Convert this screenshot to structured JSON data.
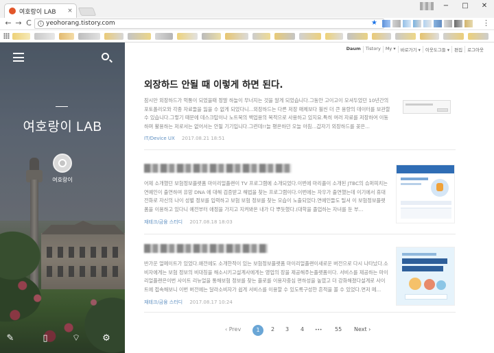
{
  "browser": {
    "tab_title": "여호랑이 LAB",
    "tab_close": "×",
    "window_buttons": [
      "−",
      "□",
      "✕"
    ],
    "nav": {
      "back": "←",
      "forward": "→",
      "reload": "C"
    },
    "url": "yeohorang.tistory.com",
    "star": "★",
    "menu": "⋮"
  },
  "sidebar": {
    "blog_title": "여호랑이 LAB",
    "nickname": "여호랑이",
    "footer_icons": [
      "pencil-icon",
      "notebook-icon",
      "rss-icon",
      "gear-icon"
    ]
  },
  "topnav": {
    "items": [
      "Daum",
      "Tistory",
      "My ▾",
      "바로가기 ▾",
      "이웃도그들 ▾",
      "편집",
      "로그아웃"
    ]
  },
  "posts": [
    {
      "title": "외장하드 안될 때 이렇게 하면 된다.",
      "excerpt": "잠시만 외장하드가 먹통이 되었을때 정말 하늘이 무너지는 것을 알게 되었습니다.그동안 고이고이 모셔두었던 10년간의 포토폴리오와 각종 자료들을 잃을 수 없게 되었다니...외장하드는 다른 저장 매체보다 훨씬 더 큰 용량의 데이터를 보관할 수 있습니다.그렇기 때문에 데스크탑이나 노트북의 백업용의 목적으로 사용하고 있지요.특히 여러 자료를 저장하여 이동하며 활용하는 저로서는 없어서는 안될 기기입니다.그런데!!늘 평온하던 오늘 아침...갑자기 외장하드를 꽂은...",
      "category": "IT/Device UX",
      "date": "2017.08.21 18:51"
    },
    {
      "title": "",
      "excerpt": "어제 소개했던 보험정보플랫폼 마이리얼플랜이 TV 프로그램에 소개되었다.이번에 마리플이 소개된 JTBC의 슈퍼피치는 연예인이 출연하여 유망 DNA 에 대해 검증받고 해법을 찾는 프로그램이다.이번에는 자우가 출연했는데 이기에서 휴대전화로 자신의 나이 성별 정보를 입력하고 보험 보험 정보를 찾는 모습이 노출되었다.연예인들도 틸셔 이 보험정보플랫폼을 이용하고 있다니 예전부터 애정을 가지고 지켜봐온 내가 다 뿌듯했다.(대학을 졸업하는 자녀를 둔 부...",
      "category": "재테크/금융 스터디",
      "date": "2017.08.18 18:03"
    },
    {
      "title": "",
      "excerpt": "반가운 얼메이트가 있었다.얘전에도 소개한적이 있는 보험정보플랫폼 마이리얼플랜이새로운 버전으로 다시 나타났다.소비자에게는 보험 정보의 비대칭을 해소시키고설계사에게는 영업의 장을 제공해주는플랫폼이다. 서비스를 제공하는 마이리얼플랜은이번 사이트 리뉴얼을 통해보험 정보를 찾는 플로를 이용자중심 편하성을 높였고 더 강화해졌다설계로 사이트에 접속해보니 이번 버전에는 달라소비자가 쉽게 서비스를 이용할 수 있도록구성한 흔적을 볼 수 있었다.면저 메...",
      "category": "재테크/금융 스터디",
      "date": "2017.08.17 10:24"
    }
  ],
  "pagination": {
    "prev": "‹ Prev",
    "pages": [
      "1",
      "2",
      "3",
      "4"
    ],
    "ellipsis": "• • •",
    "last": "55",
    "next": "Next ›",
    "current": "1"
  },
  "colors": {
    "accent": "#6aa6d6",
    "category": "#5e8fc1",
    "favicon": "#e2562a"
  }
}
